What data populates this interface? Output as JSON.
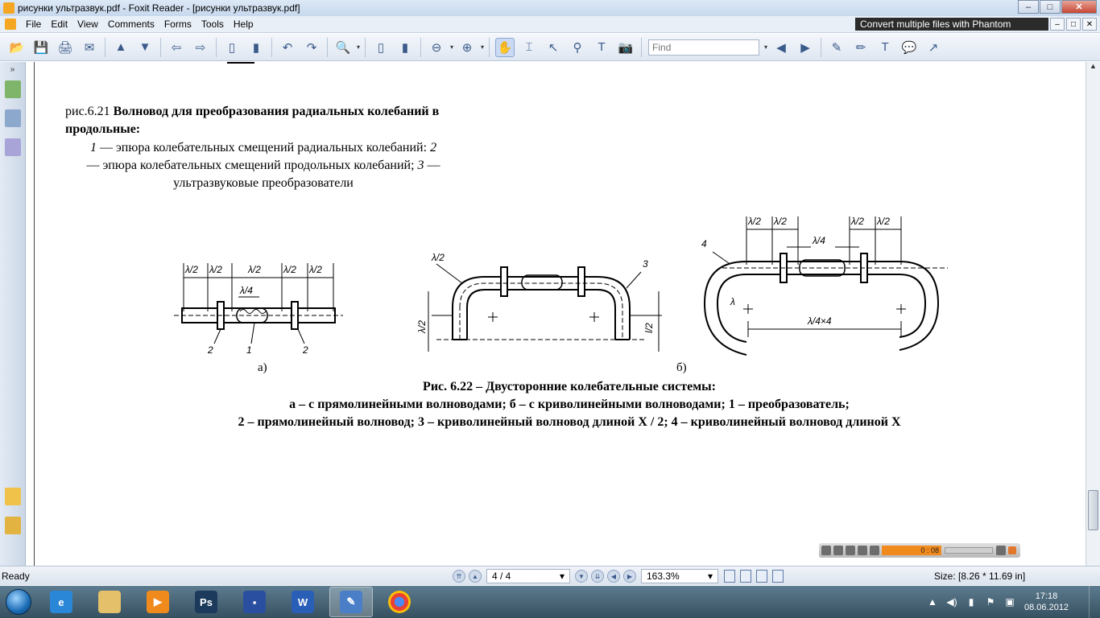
{
  "window": {
    "title": "рисунки ультразвук.pdf - Foxit Reader - [рисунки ультразвук.pdf]",
    "minimize_label": "–",
    "maximize_label": "□",
    "close_label": "✕"
  },
  "menu": {
    "items": [
      "File",
      "Edit",
      "View",
      "Comments",
      "Forms",
      "Tools",
      "Help"
    ],
    "promo": "Convert multiple files with Phantom",
    "doc_btn_min": "–",
    "doc_btn_restore": "□",
    "doc_btn_close": "✕"
  },
  "toolbar": {
    "find_placeholder": "Find",
    "icons": {
      "open": "📂",
      "save": "💾",
      "print": "🖨",
      "email": "✉",
      "prev": "▲",
      "next": "▼",
      "back": "⇦",
      "forward": "⇨",
      "undo": "↶",
      "redo": "↷",
      "zoom": "🔍",
      "fit_page": "▯",
      "fit_width": "▮",
      "zoom_out": "⊖",
      "zoom_in": "⊕",
      "hand": "✋",
      "select": "⌶",
      "arrow": "↖",
      "binoculars": "⚲",
      "typewriter": "T",
      "snapshot": "📷",
      "find_prev": "◀",
      "find_next": "▶",
      "note": "✎",
      "pen": "✏",
      "text": "T",
      "comment": "💬",
      "arrow_tool": "↗"
    }
  },
  "document": {
    "fig621": {
      "label": "рис.6.21",
      "title": "Волновод для преобразования радиальных колебаний в продольные:",
      "legend_1": "1",
      "legend_1_text": " — эпюра колебательных смещений радиальных колебаний: ",
      "legend_2": "2",
      "legend_2_text": " — эпюра колебательных смещений продольных колебаний; ",
      "legend_3": "3",
      "legend_3_text": " — ультразвуковые преобразователи"
    },
    "fig622": {
      "sub_a": "а)",
      "sub_b": "б)",
      "caption_line1": "Рис. 6.22 – Двусторонние колебательные системы:",
      "caption_line2": "а – с прямолинейными волноводами; б – с криволинейными волноводами; 1 – преобразователь;",
      "caption_line3": "2 – прямолинейный волновод; 3 – криволинейный волновод длиной X / 2; 4 – криволинейный волновод длиной X",
      "diagram_a": {
        "dims": [
          "λ/2",
          "λ/2",
          "λ/2",
          "λ/2",
          "λ/2"
        ],
        "quarter": "λ/4",
        "labels": [
          "2",
          "1",
          "2"
        ]
      },
      "diagram_b1": {
        "lambda_half": "λ/2",
        "left_dim": "λ/2",
        "right_dim": "l/2",
        "label3": "3"
      },
      "diagram_b2": {
        "dims": [
          "λ/2",
          "λ/2",
          "λ/2",
          "λ/2"
        ],
        "quarter": "λ/4",
        "bottom_dim": "λ/4×4",
        "label4": "4",
        "lambda": "λ"
      }
    }
  },
  "media_player": {
    "time": "0 : 08"
  },
  "statusbar": {
    "ready": "Ready",
    "page": "4 / 4",
    "zoom": "163.3%",
    "size": "Size: [8.26 * 11.69 in]",
    "dropdown": "▾"
  },
  "taskbar": {
    "clock_time": "17:18",
    "clock_date": "08.06.2012",
    "apps": [
      "ie",
      "explorer",
      "media",
      "photoshop",
      "save",
      "word",
      "foxit",
      "chrome"
    ],
    "ps_label": "Ps",
    "word_label": "W"
  }
}
